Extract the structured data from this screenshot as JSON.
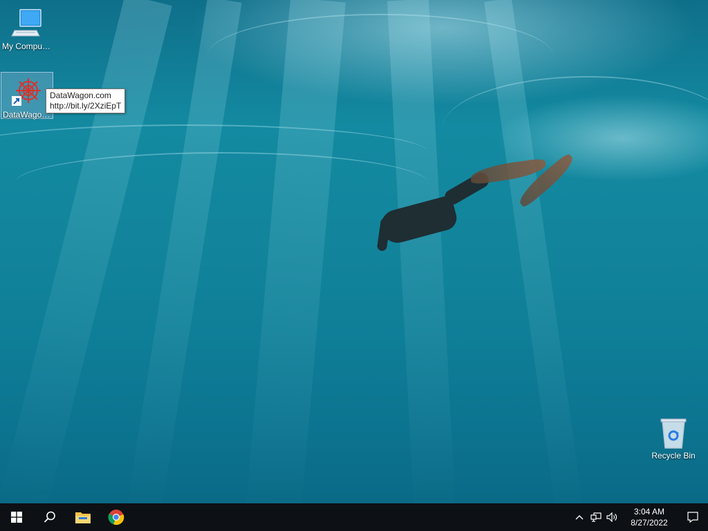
{
  "desktop": {
    "icons": [
      {
        "label": "My Computer"
      },
      {
        "label": "DataWagon..."
      },
      {
        "label": "Recycle Bin"
      }
    ],
    "tooltip": {
      "line1": "DataWagon.com",
      "line2": "http://bit.ly/2XziEpT"
    }
  },
  "taskbar": {
    "buttons": [
      "windows-start-icon",
      "search-icon",
      "file-explorer-icon",
      "chrome-icon"
    ],
    "tray_icons": [
      "chevron-up-icon",
      "network-icon",
      "volume-icon"
    ],
    "time": "3:04 AM",
    "date": "8/27/2022"
  },
  "colors": {
    "taskbar": "#0d1014",
    "desktop_water": "#138aa1",
    "accent_folder": "#f2c14e"
  }
}
